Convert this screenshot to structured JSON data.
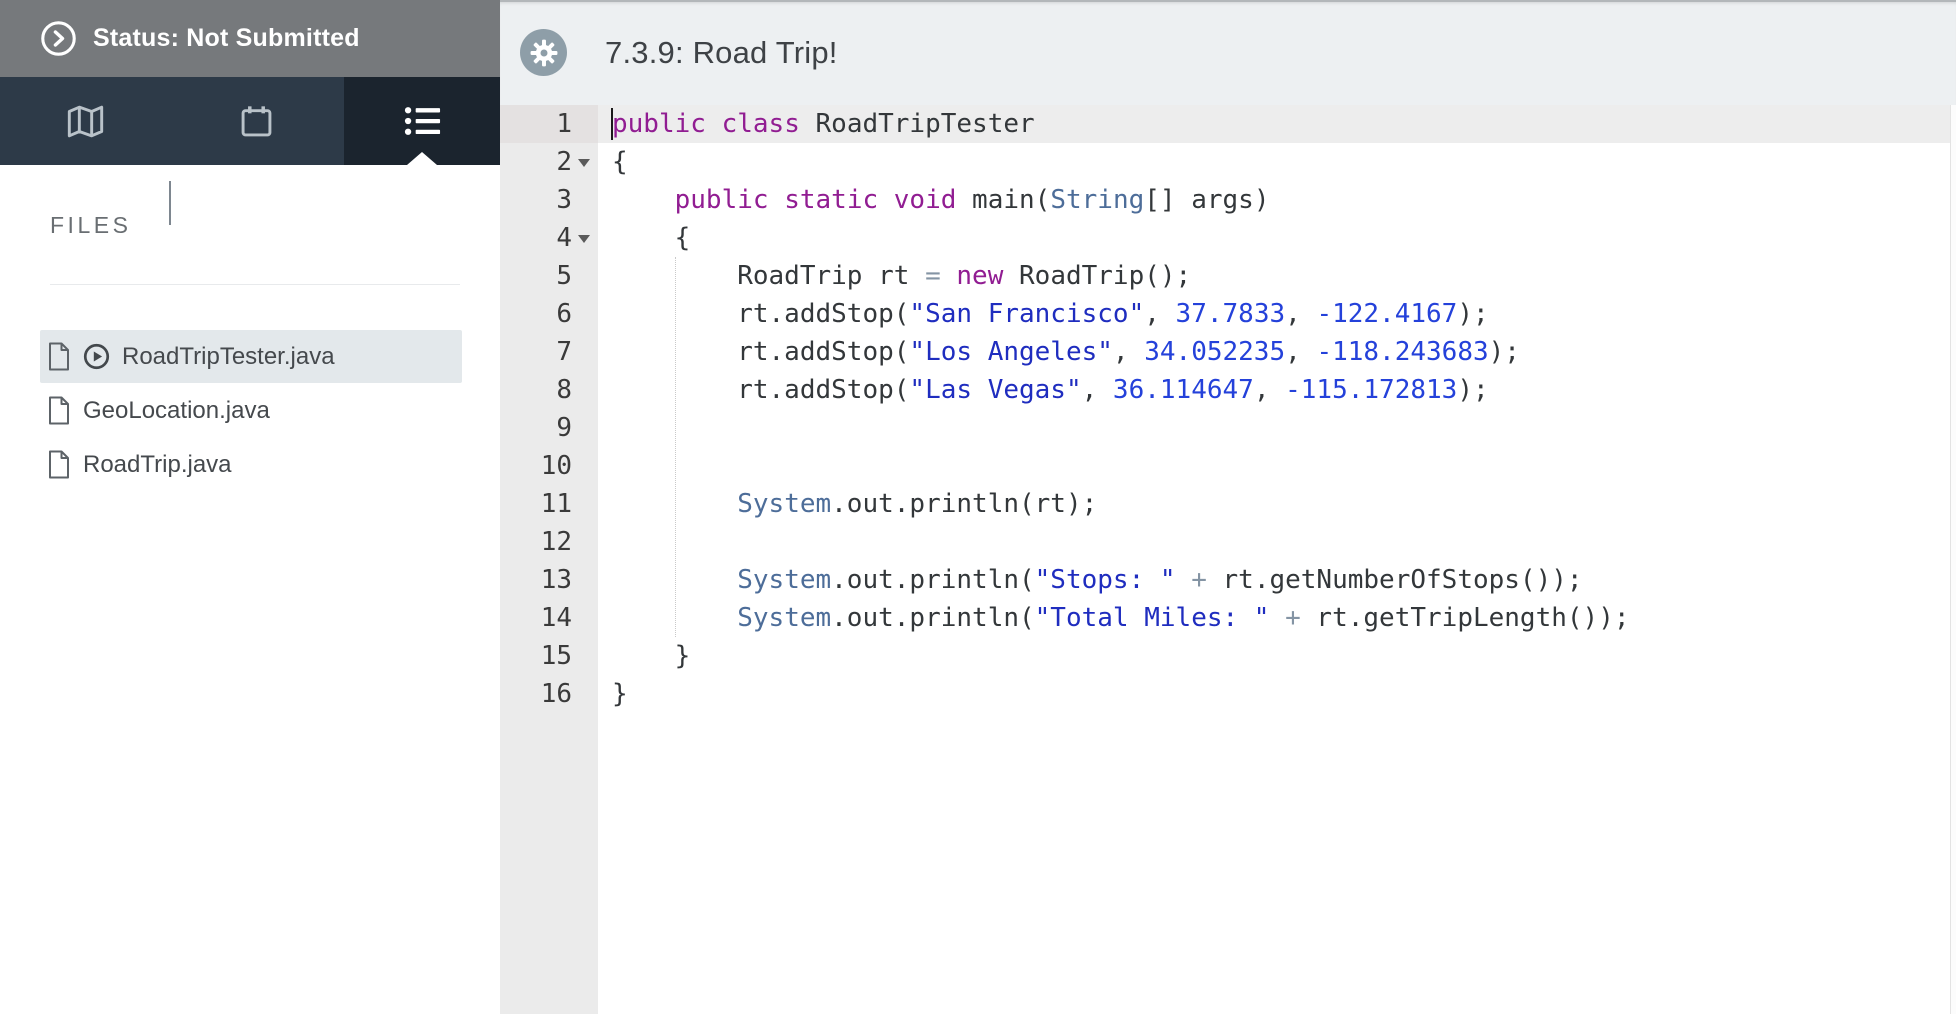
{
  "status_bar": {
    "label": "Status: Not Submitted"
  },
  "nav_tabs": [
    {
      "id": "map",
      "icon": "map-icon",
      "active": false
    },
    {
      "id": "calendar",
      "icon": "calendar-icon",
      "active": false
    },
    {
      "id": "list",
      "icon": "list-icon",
      "active": true
    }
  ],
  "files_panel": {
    "header": "FILES",
    "files": [
      {
        "name": "RoadTripTester.java",
        "selected": true,
        "runnable": true
      },
      {
        "name": "GeoLocation.java",
        "selected": false,
        "runnable": false
      },
      {
        "name": "RoadTrip.java",
        "selected": false,
        "runnable": false
      }
    ]
  },
  "editor": {
    "title": "7.3.9: Road Trip!",
    "language": "java",
    "active_line": 1,
    "folded_gutter_lines": [
      2,
      4
    ],
    "token_classes": {
      "k": "keyword",
      "t": "type",
      "s": "string",
      "n": "number",
      "o": "operator",
      "p": "plain"
    },
    "lines": [
      [
        {
          "c": "k",
          "t": "public"
        },
        {
          "c": "p",
          "t": " "
        },
        {
          "c": "k",
          "t": "class"
        },
        {
          "c": "p",
          "t": " RoadTripTester"
        }
      ],
      [
        {
          "c": "p",
          "t": "{"
        }
      ],
      [
        {
          "c": "p",
          "t": "    "
        },
        {
          "c": "k",
          "t": "public"
        },
        {
          "c": "p",
          "t": " "
        },
        {
          "c": "k",
          "t": "static"
        },
        {
          "c": "p",
          "t": " "
        },
        {
          "c": "k",
          "t": "void"
        },
        {
          "c": "p",
          "t": " main("
        },
        {
          "c": "t",
          "t": "String"
        },
        {
          "c": "p",
          "t": "[] args)"
        }
      ],
      [
        {
          "c": "p",
          "t": "    {"
        }
      ],
      [
        {
          "c": "p",
          "t": "        RoadTrip rt "
        },
        {
          "c": "o",
          "t": "="
        },
        {
          "c": "p",
          "t": " "
        },
        {
          "c": "k",
          "t": "new"
        },
        {
          "c": "p",
          "t": " RoadTrip();"
        }
      ],
      [
        {
          "c": "p",
          "t": "        rt.addStop("
        },
        {
          "c": "s",
          "t": "\"San Francisco\""
        },
        {
          "c": "p",
          "t": ", "
        },
        {
          "c": "n",
          "t": "37.7833"
        },
        {
          "c": "p",
          "t": ", "
        },
        {
          "c": "n",
          "t": "-122.4167"
        },
        {
          "c": "p",
          "t": ");"
        }
      ],
      [
        {
          "c": "p",
          "t": "        rt.addStop("
        },
        {
          "c": "s",
          "t": "\"Los Angeles\""
        },
        {
          "c": "p",
          "t": ", "
        },
        {
          "c": "n",
          "t": "34.052235"
        },
        {
          "c": "p",
          "t": ", "
        },
        {
          "c": "n",
          "t": "-118.243683"
        },
        {
          "c": "p",
          "t": ");"
        }
      ],
      [
        {
          "c": "p",
          "t": "        rt.addStop("
        },
        {
          "c": "s",
          "t": "\"Las Vegas\""
        },
        {
          "c": "p",
          "t": ", "
        },
        {
          "c": "n",
          "t": "36.114647"
        },
        {
          "c": "p",
          "t": ", "
        },
        {
          "c": "n",
          "t": "-115.172813"
        },
        {
          "c": "p",
          "t": ");"
        }
      ],
      [],
      [],
      [
        {
          "c": "p",
          "t": "        "
        },
        {
          "c": "t",
          "t": "System"
        },
        {
          "c": "p",
          "t": ".out.println(rt);"
        }
      ],
      [],
      [
        {
          "c": "p",
          "t": "        "
        },
        {
          "c": "t",
          "t": "System"
        },
        {
          "c": "p",
          "t": ".out.println("
        },
        {
          "c": "s",
          "t": "\"Stops: \""
        },
        {
          "c": "p",
          "t": " "
        },
        {
          "c": "o",
          "t": "+"
        },
        {
          "c": "p",
          "t": " rt.getNumberOfStops());"
        }
      ],
      [
        {
          "c": "p",
          "t": "        "
        },
        {
          "c": "t",
          "t": "System"
        },
        {
          "c": "p",
          "t": ".out.println("
        },
        {
          "c": "s",
          "t": "\"Total Miles: \""
        },
        {
          "c": "p",
          "t": " "
        },
        {
          "c": "o",
          "t": "+"
        },
        {
          "c": "p",
          "t": " rt.getTripLength());"
        }
      ],
      [
        {
          "c": "p",
          "t": "    }"
        }
      ],
      [
        {
          "c": "p",
          "t": "}"
        }
      ]
    ]
  },
  "colors": {
    "status_bar_bg": "#76797c",
    "tab_bar_bg": "#2d3a48",
    "tab_active_bg": "#1b242e",
    "editor_header_bg": "#edf0f2",
    "gutter_bg": "#ebebeb",
    "active_line_bg": "#ededed",
    "selected_file_bg": "#e3e8eb",
    "keyword": "#911d92",
    "type": "#4d6d99",
    "string": "#1f2dbf",
    "number": "#2441da",
    "operator": "#8494a4",
    "plain": "#33373a"
  }
}
